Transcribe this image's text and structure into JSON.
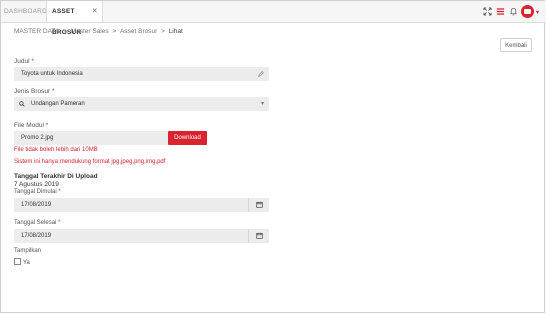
{
  "tabs": [
    {
      "label": "DASHBOARD"
    },
    {
      "label": "ASSET BROSUR",
      "close": "✕"
    }
  ],
  "toolbar": {
    "icons": [
      "expand-icon",
      "menu-icon",
      "bell-icon",
      "user-avatar"
    ],
    "accent": "#d9232e"
  },
  "breadcrumb": {
    "items": [
      "MASTER DATA",
      "Master Sales",
      "Asset Brosur",
      "Lihat"
    ],
    "separator": ">"
  },
  "kembali_label": "Kembali",
  "form": {
    "judul": {
      "label": "Judul",
      "required": "*",
      "value": "Toyota untuk Indonesia"
    },
    "jenis": {
      "label": "Jenis Brosur",
      "required": "*",
      "value": "Undangan Pameran"
    },
    "file": {
      "label": "File Modul",
      "required": "*",
      "value": "Promo 2.jpg",
      "download_label": "Download",
      "warning_size": "File tidak boleh lebih dari 10MB",
      "warning_format": "Sistem ini hanya mendukung format jpg,jpeg,png,img,pdf"
    },
    "upload": {
      "title": "Tanggal Terakhir Di Upload",
      "value": "7 Agustus 2019"
    },
    "tanggal_dimulai": {
      "label": "Tanggal Dimulai",
      "required": "*",
      "value": "17/08/2019"
    },
    "tanggal_selesai": {
      "label": "Tanggal Selesai",
      "required": "*",
      "value": "17/08/2019"
    },
    "tampilkan": {
      "label": "Tampilkan",
      "option": "Ya"
    }
  }
}
